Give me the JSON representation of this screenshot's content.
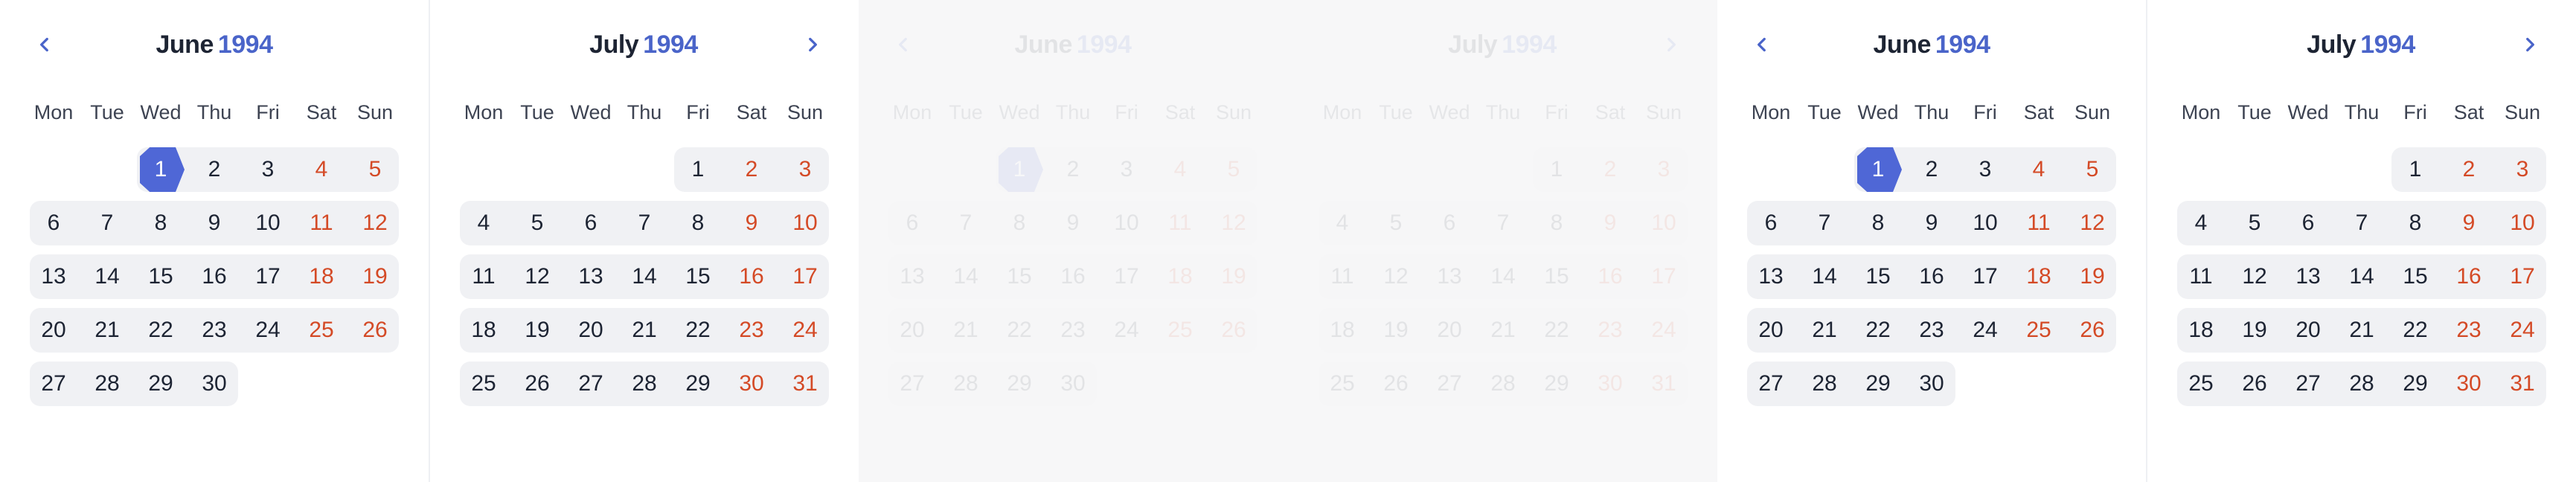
{
  "weekdays": [
    "Mon",
    "Tue",
    "Wed",
    "Thu",
    "Fri",
    "Sat",
    "Sun"
  ],
  "colors": {
    "accent": "#4f67d6",
    "year": "#4a64c9",
    "weekend": "#d44a26",
    "text": "#1d2433"
  },
  "icons": {
    "prev": "chevron-left-icon",
    "next": "chevron-right-icon"
  },
  "panels": [
    {
      "state": "active",
      "months": [
        {
          "month": "June",
          "year": "1994",
          "first_weekday": 2,
          "days_in_month": 30,
          "selected_day": 1,
          "nav": "prev"
        },
        {
          "month": "July",
          "year": "1994",
          "first_weekday": 4,
          "days_in_month": 31,
          "selected_day": null,
          "nav": "next"
        }
      ]
    },
    {
      "state": "faded",
      "months": [
        {
          "month": "June",
          "year": "1994",
          "first_weekday": 2,
          "days_in_month": 30,
          "selected_day": 1,
          "nav": "prev"
        },
        {
          "month": "July",
          "year": "1994",
          "first_weekday": 4,
          "days_in_month": 31,
          "selected_day": null,
          "nav": "next"
        }
      ]
    },
    {
      "state": "active",
      "months": [
        {
          "month": "June",
          "year": "1994",
          "first_weekday": 2,
          "days_in_month": 30,
          "selected_day": 1,
          "nav": "prev"
        },
        {
          "month": "July",
          "year": "1994",
          "first_weekday": 4,
          "days_in_month": 31,
          "selected_day": null,
          "nav": "next"
        }
      ]
    }
  ]
}
